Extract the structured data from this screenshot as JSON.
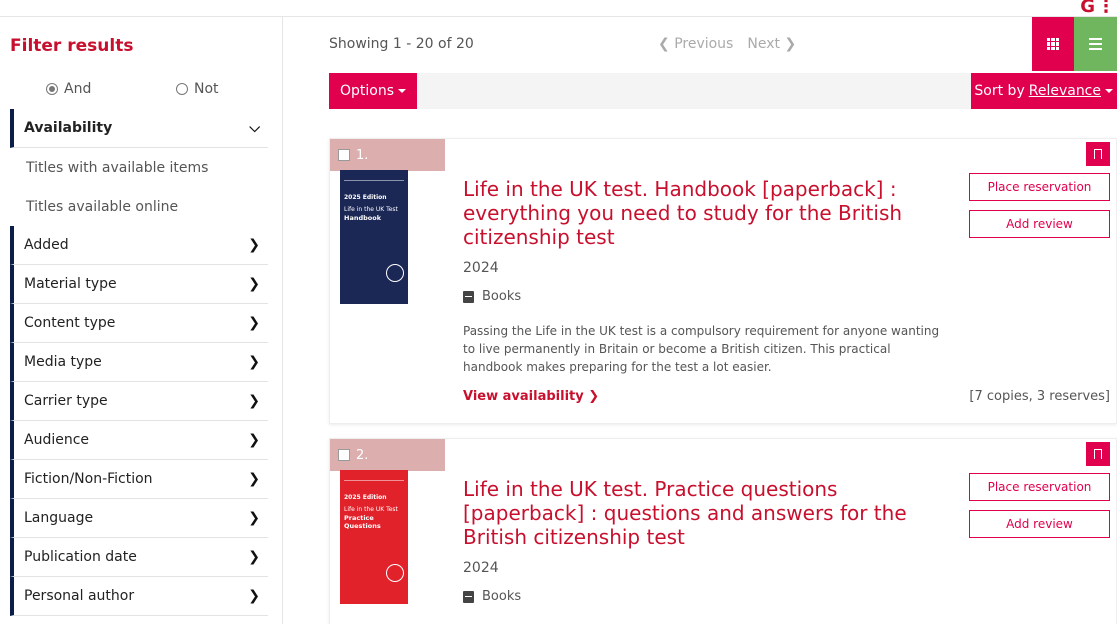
{
  "brand": {
    "logo_letter": "G",
    "accent": "#e0004d",
    "title_color": "#c8102e"
  },
  "sidebar": {
    "title": "Filter results",
    "and_label": "And",
    "not_label": "Not",
    "availability": {
      "label": "Availability",
      "items": [
        "Titles with available items",
        "Titles available online"
      ]
    },
    "facets": [
      "Added",
      "Material type",
      "Content type",
      "Media type",
      "Carrier type",
      "Audience",
      "Fiction/Non-Fiction",
      "Language",
      "Publication date",
      "Personal author"
    ]
  },
  "main": {
    "showing": "Showing 1 - 20 of 20",
    "previous": "Previous",
    "next": "Next",
    "options_label": "Options",
    "sort_prefix": "Sort by",
    "sort_value": "Relevance"
  },
  "results": [
    {
      "number": "1.",
      "title": "Life in the UK test. Handbook [paperback] : everything you need to study for the British citizenship test",
      "year": "2024",
      "format": "Books",
      "description": "Passing the Life in the UK test is a compulsory requirement for anyone wanting to live permanently in Britain or become a British citizen. This practical handbook makes preparing for the test a lot easier.",
      "availability_link": "View availability",
      "copies": "[7 copies, 3 reserves]",
      "place_label": "Place reservation",
      "review_label": "Add review",
      "cover_edition": "2025 Edition",
      "cover_line1": "Life in the UK Test",
      "cover_line2": "Handbook"
    },
    {
      "number": "2.",
      "title": "Life in the UK test. Practice questions [paperback] : questions and answers for the British citizenship test",
      "year": "2024",
      "format": "Books",
      "place_label": "Place reservation",
      "review_label": "Add review",
      "cover_edition": "2025 Edition",
      "cover_line1": "Life in the UK Test",
      "cover_line2": "Practice Questions"
    }
  ]
}
